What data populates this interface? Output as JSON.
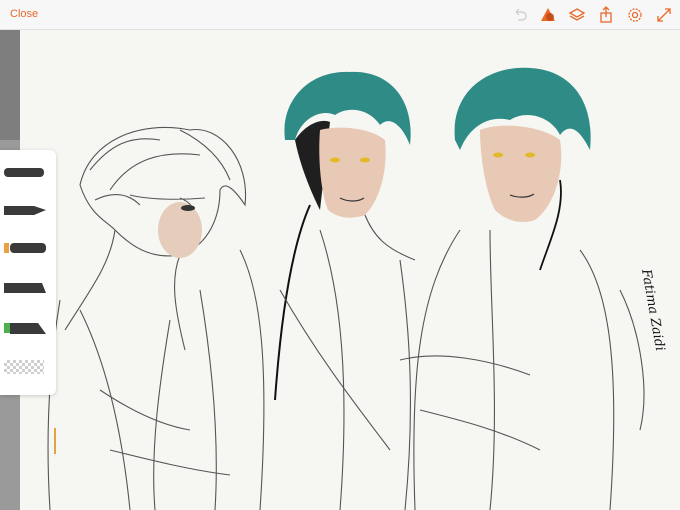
{
  "topbar": {
    "close_label": "Close",
    "icons": [
      "undo-icon",
      "shape-color-icon",
      "layers-icon",
      "share-icon",
      "settings-icon",
      "expand-icon"
    ],
    "accent_color": "#e8692a"
  },
  "brush_panel": {
    "brushes": [
      {
        "name": "brush-1",
        "accent": "#3a3a3a"
      },
      {
        "name": "brush-2",
        "accent": "#3a3a3a"
      },
      {
        "name": "brush-3",
        "accent": "#e8a040"
      },
      {
        "name": "brush-4",
        "accent": "#3a3a3a"
      },
      {
        "name": "brush-5",
        "accent": "#4caf50"
      }
    ],
    "eraser": "transparency-icon"
  },
  "canvas": {
    "signature_text": "Fatima Zaidi",
    "hair_color": "#2e8b86",
    "skin_color": "#e8c9b6",
    "eye_color": "#e3b92a"
  }
}
